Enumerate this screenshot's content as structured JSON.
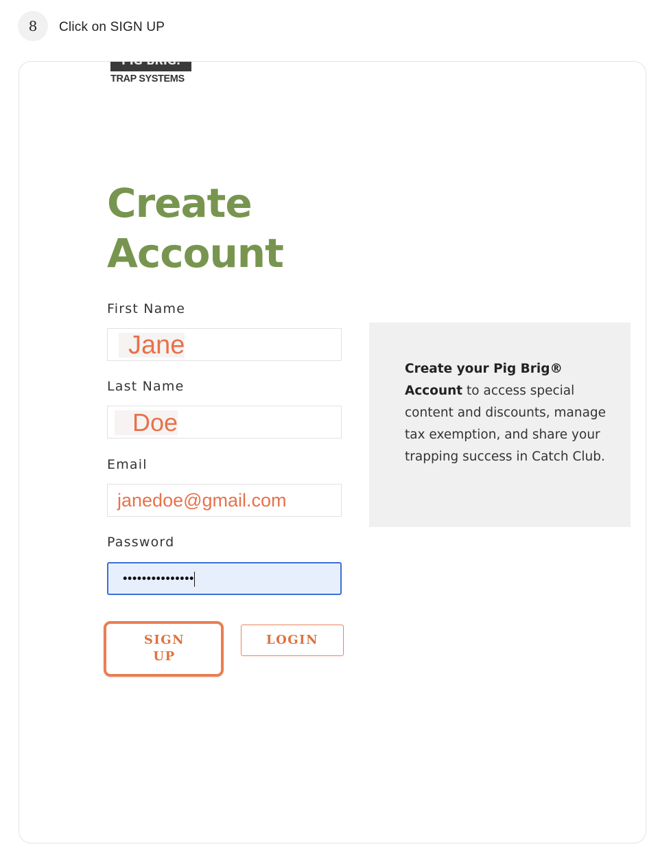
{
  "step": {
    "number": "8",
    "instruction": "Click on SIGN UP"
  },
  "logo": {
    "top_text": "PIG BRIG.",
    "bottom_text": "TRAP SYSTEMS"
  },
  "form": {
    "title_line1": "Create",
    "title_line2": "Account",
    "first_name": {
      "label": "First Name",
      "value": "Jane"
    },
    "last_name": {
      "label": "Last Name",
      "value": "Doe"
    },
    "email": {
      "label": "Email",
      "value": "janedoe@gmail.com"
    },
    "password": {
      "label": "Password",
      "value": "•••••••••••••••"
    },
    "signup_line1": "SIGN",
    "signup_line2": "UP",
    "login_label": "LOGIN"
  },
  "info": {
    "bold_text": "Create your Pig Brig® Account",
    "body_text": " to access special content and discounts, manage tax exemption, and share your trapping success in Catch Club."
  },
  "colors": {
    "title_green": "#77954f",
    "accent_orange": "#e8714a",
    "focus_blue": "#3a6fd8",
    "info_bg": "#f0f0f0"
  }
}
